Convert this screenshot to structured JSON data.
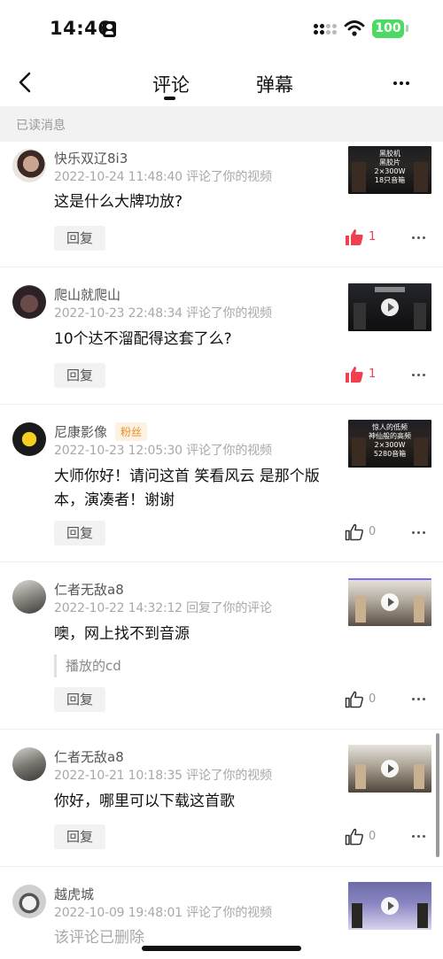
{
  "status_bar": {
    "time": "14:46",
    "battery": "100"
  },
  "nav": {
    "tabs": [
      {
        "label": "评论"
      },
      {
        "label": "弹幕"
      }
    ],
    "active_tab": "评论"
  },
  "section_header": "已读消息",
  "comments": [
    {
      "user": "快乐双辽8i3",
      "meta": "2022-10-24 11:48:40 评论了你的视频",
      "text": "这是什么大牌功放?",
      "reply_label": "回复",
      "likes": "1",
      "liked": true,
      "thumb_text": "黑胶机\n黑胶片\n2×300W\n18只音箱"
    },
    {
      "user": "爬山就爬山",
      "meta": "2022-10-23 22:48:34 评论了你的视频",
      "text": "10个达不溜配得这套了么?",
      "reply_label": "回复",
      "likes": "1",
      "liked": true,
      "thumb_text": ""
    },
    {
      "user": "尼康影像",
      "badge": "粉丝",
      "meta": "2022-10-23 12:05:30 评论了你的视频",
      "text": "大师你好！请问这首 笑看风云 是那个版本，演凑者！谢谢",
      "reply_label": "回复",
      "likes": "0",
      "liked": false,
      "thumb_text": "惊人的低频\n神仙般的高频\n2×300W\n5280音箱"
    },
    {
      "user": "仁者无敌a8",
      "meta": "2022-10-22 14:32:12 回复了你的评论",
      "text": "噢，网上找不到音源",
      "quote": "播放的cd",
      "reply_label": "回复",
      "likes": "0",
      "liked": false,
      "thumb_text": ""
    },
    {
      "user": "仁者无敌a8",
      "meta": "2022-10-21 10:18:35 评论了你的视频",
      "text": "你好，哪里可以下载这首歌",
      "reply_label": "回复",
      "likes": "0",
      "liked": false,
      "thumb_text": ""
    },
    {
      "user": "越虎城",
      "meta": "2022-10-09 19:48:01 评论了你的视频",
      "text": "该评论已删除"
    }
  ],
  "colors": {
    "like_active": "#f04050",
    "battery": "#4cd964",
    "badge_text": "#e5902c"
  },
  "icons": [
    "id-card-icon",
    "signal-icon",
    "wifi-icon",
    "back-icon",
    "more-icon",
    "thumb-up-icon",
    "play-icon"
  ]
}
